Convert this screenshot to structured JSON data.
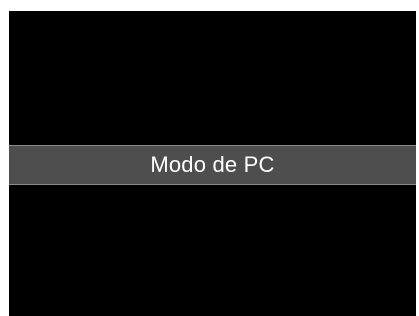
{
  "screen": {
    "banner": {
      "label": "Modo de PC"
    }
  },
  "colors": {
    "screen_background": "#000000",
    "banner_background": "#4e4e4e",
    "banner_border": "#8a8a8a",
    "label_text": "#ffffff",
    "frame_background": "#ffffff"
  }
}
